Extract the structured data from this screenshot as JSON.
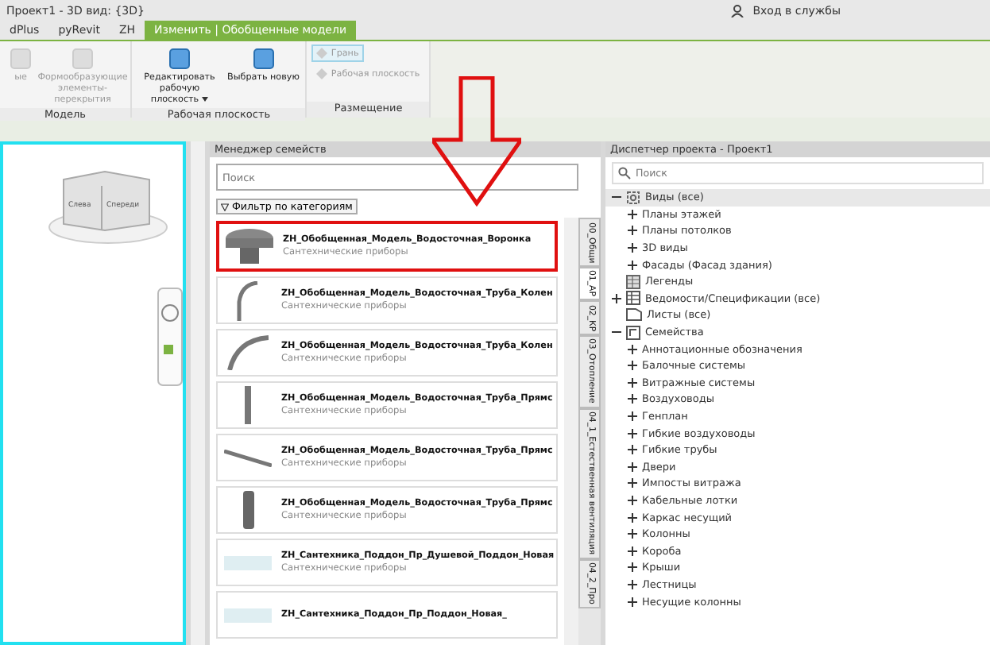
{
  "window": {
    "title": "Проект1 - 3D вид: {3D}",
    "signin": "Вход в службы"
  },
  "ribbon_tabs": [
    {
      "label": "dPlus",
      "selected": false
    },
    {
      "label": "pyRevit",
      "selected": false
    },
    {
      "label": "ZH",
      "selected": false
    },
    {
      "label": "Изменить | Обобщенные модели",
      "selected": true
    }
  ],
  "ribbon_panels": [
    {
      "title": "Модель",
      "buttons": [
        {
          "kind": "large",
          "label": "ые",
          "disabled": true
        },
        {
          "kind": "large",
          "label": "Формообразующие элементы-перекрытия",
          "disabled": true
        }
      ]
    },
    {
      "title": "Рабочая плоскость",
      "buttons": [
        {
          "kind": "large",
          "label": "Редактировать рабочую плоскость",
          "disabled": false,
          "caret": true
        },
        {
          "kind": "large",
          "label": "Выбрать новую",
          "disabled": false
        }
      ]
    },
    {
      "title": "Размещение",
      "buttons": [
        {
          "kind": "small",
          "label": "Грань",
          "disabled": true,
          "selected": true
        },
        {
          "kind": "small",
          "label": "Рабочая плоскость",
          "disabled": true,
          "selected": false
        }
      ]
    }
  ],
  "viewcube": {
    "faces": [
      "Слева",
      "Спереди"
    ]
  },
  "family_manager": {
    "title": "Менеджер семейств",
    "search": {
      "placeholder": "Поиск"
    },
    "filter": "Фильтр по категориям",
    "items": [
      {
        "name": "ZH_Обобщенная_Модель_Водосточная_Воронка",
        "category": "Сантехнические приборы",
        "kind": "funnel",
        "highlighted": true
      },
      {
        "name": "ZH_Обобщенная_Модель_Водосточная_Труба_Колен",
        "category": "Сантехнические приборы",
        "kind": "bend",
        "highlighted": false
      },
      {
        "name": "ZH_Обобщенная_Модель_Водосточная_Труба_Колен",
        "category": "Сантехнические приборы",
        "kind": "arc",
        "highlighted": false
      },
      {
        "name": "ZH_Обобщенная_Модель_Водосточная_Труба_Прямс",
        "category": "Сантехнические приборы",
        "kind": "vertical",
        "highlighted": false
      },
      {
        "name": "ZH_Обобщенная_Модель_Водосточная_Труба_Прямс",
        "category": "Сантехнические приборы",
        "kind": "diagonal",
        "highlighted": false
      },
      {
        "name": "ZH_Обобщенная_Модель_Водосточная_Труба_Прямс",
        "category": "Сантехнические приборы",
        "kind": "thick",
        "highlighted": false
      },
      {
        "name": "ZH_Сантехника_Поддон_Пр_Душевой_Поддон_Новая",
        "category": "Сантехнические приборы",
        "kind": "tray",
        "highlighted": false
      },
      {
        "name": "ZH_Сантехника_Поддон_Пр_Поддон_Новая_",
        "kind": "tray",
        "highlighted": false
      }
    ],
    "tabs": [
      {
        "label": "00_Общи",
        "selected": false
      },
      {
        "label": "01_АР",
        "selected": true
      },
      {
        "label": "02_КР",
        "selected": false
      },
      {
        "label": "03_Отопление",
        "selected": false
      },
      {
        "label": "04_1_Естественная вентиляция",
        "selected": false
      },
      {
        "label": "04_2_Про",
        "selected": false
      }
    ]
  },
  "project_browser": {
    "title": "Диспетчер проекта - Проект1",
    "search": {
      "placeholder": "Поиск"
    },
    "tree": [
      {
        "label": "Виды (все)",
        "kind": "views",
        "expanded": true,
        "children": [
          {
            "label": "Планы этажей",
            "expanded": false
          },
          {
            "label": "Планы потолков",
            "expanded": false
          },
          {
            "label": "3D виды",
            "expanded": false
          },
          {
            "label": "Фасады (Фасад здания)",
            "expanded": false
          }
        ]
      },
      {
        "label": "Легенды",
        "kind": "legend"
      },
      {
        "label": "Ведомости/Спецификации (все)",
        "kind": "schedule",
        "expanded": false
      },
      {
        "label": "Листы (все)",
        "kind": "sheet"
      },
      {
        "label": "Семейства",
        "kind": "family",
        "expanded": true,
        "children": [
          {
            "label": "Аннотационные обозначения",
            "expanded": false
          },
          {
            "label": "Балочные системы",
            "expanded": false
          },
          {
            "label": "Витражные системы",
            "expanded": false
          },
          {
            "label": "Воздуховоды",
            "expanded": false
          },
          {
            "label": "Генплан",
            "expanded": false
          },
          {
            "label": "Гибкие воздуховоды",
            "expanded": false
          },
          {
            "label": "Гибкие трубы",
            "expanded": false
          },
          {
            "label": "Двери",
            "expanded": false
          },
          {
            "label": "Импосты витража",
            "expanded": false
          },
          {
            "label": "Кабельные лотки",
            "expanded": false
          },
          {
            "label": "Каркас несущий",
            "expanded": false
          },
          {
            "label": "Колонны",
            "expanded": false
          },
          {
            "label": "Короба",
            "expanded": false
          },
          {
            "label": "Крыши",
            "expanded": false
          },
          {
            "label": "Лестницы",
            "expanded": false
          },
          {
            "label": "Несущие колонны",
            "expanded": false
          }
        ]
      }
    ]
  }
}
